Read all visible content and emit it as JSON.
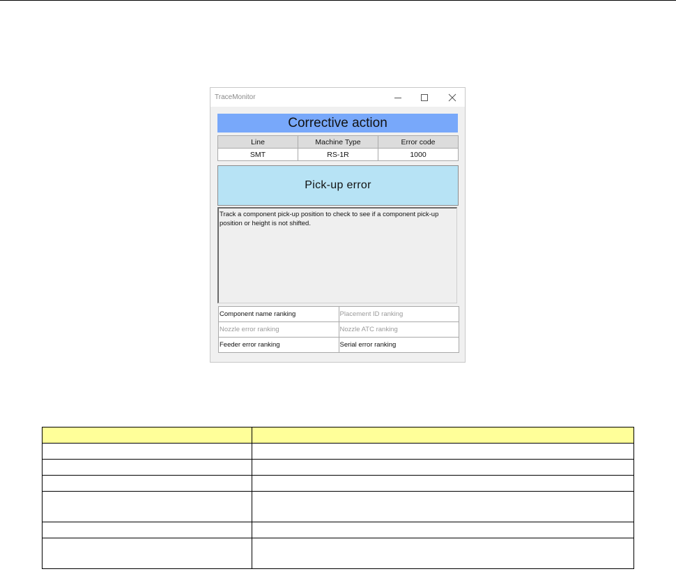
{
  "window": {
    "title": "TraceMonitor",
    "controls": {
      "minimize_icon": "minimize-icon",
      "maximize_icon": "maximize-icon",
      "close_icon": "close-icon"
    }
  },
  "banner": {
    "title": "Corrective action"
  },
  "info": {
    "headers": [
      "Line",
      "Machine Type",
      "Error code"
    ],
    "values": [
      "SMT",
      "RS-1R",
      "1000"
    ]
  },
  "error_panel": {
    "label": "Pick-up error"
  },
  "description": {
    "text": "Track a component pick-up position to check to see if a component pick-up position or height is not shifted."
  },
  "rankings": {
    "items": [
      {
        "label": "Component name ranking",
        "enabled": true
      },
      {
        "label": "Placement ID ranking",
        "enabled": false
      },
      {
        "label": "Nozzle error ranking",
        "enabled": false
      },
      {
        "label": "Nozzle ATC ranking",
        "enabled": false
      },
      {
        "label": "Feeder error ranking",
        "enabled": true
      },
      {
        "label": "Serial error ranking",
        "enabled": true
      }
    ]
  },
  "colors": {
    "banner": "#78a8fa",
    "error_panel": "#b7e3f5",
    "table_header": "#ffff99"
  }
}
